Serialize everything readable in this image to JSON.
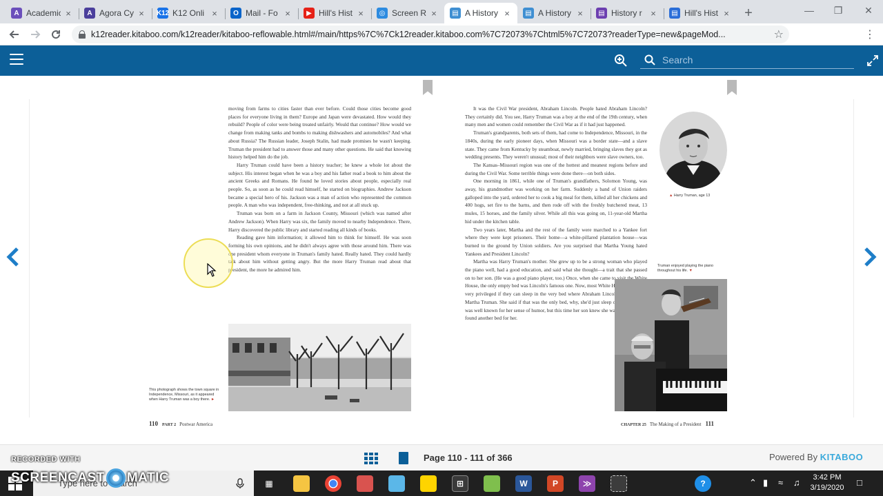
{
  "browser": {
    "tabs": [
      {
        "title": "Academic",
        "fav_letter": "A",
        "fav_color": "#6b4fbb",
        "active": false
      },
      {
        "title": "Agora Cy",
        "fav_letter": "A",
        "fav_color": "#4b3f9c",
        "active": false
      },
      {
        "title": "K12 Onli",
        "fav_letter": "K12",
        "fav_color": "#1a73e8",
        "active": false
      },
      {
        "title": "Mail - Fo",
        "fav_letter": "O",
        "fav_color": "#0a64c9",
        "active": false
      },
      {
        "title": "Hill's Hist",
        "fav_letter": "▶",
        "fav_color": "#e62117",
        "active": false
      },
      {
        "title": "Screen R",
        "fav_letter": "◎",
        "fav_color": "#2d8be0",
        "active": false
      },
      {
        "title": "A History",
        "fav_letter": "▤",
        "fav_color": "#3f8fd2",
        "active": true
      },
      {
        "title": "A History",
        "fav_letter": "▤",
        "fav_color": "#3f8fd2",
        "active": false
      },
      {
        "title": "History r",
        "fav_letter": "▤",
        "fav_color": "#6c3fb0",
        "active": false
      },
      {
        "title": "Hill's Hist",
        "fav_letter": "▤",
        "fav_color": "#2b6ed8",
        "active": false
      }
    ],
    "close_glyph": "×",
    "new_tab_glyph": "+",
    "url": "k12reader.kitaboo.com/k12reader/kitaboo-reflowable.html#/main/https%7C%7Ck12reader.kitaboo.com%7C72073%7Chtml5%7C72073?readerType=new&pageMod..."
  },
  "reader": {
    "search_placeholder": "Search",
    "left_page": {
      "paragraphs": [
        {
          "text": "moving from farms to cities faster than ever before. Could those cities become good places for everyone living in them? Europe and Japan were devastated. How would they rebuild? People of color were being treated unfairly. Would that continue? How would we change from making tanks and bombs to making dishwashers and automobiles? And what about Russia? The Russian leader, Joseph Stalin, had made promises he wasn't keeping. Truman the president had to answer those and many other questions. He said that knowing history helped him do the job.",
          "indent": false
        },
        {
          "text": "Harry Truman could have been a history teacher; he knew a whole lot about the subject. His interest began when he was a boy and his father read a book to him about the ancient Greeks and Romans. He found he loved stories about people, especially real people. So, as soon as he could read himself, he started on biographies. Andrew Jackson became a special hero of his. Jackson was a man of action who represented the common people. A man who was independent, free-thinking, and not at all stuck up.",
          "indent": true
        },
        {
          "text": "Truman was born on a farm in Jackson County, Missouri (which was named after Andrew Jackson). When Harry was six, the family moved to nearby Independence. There, Harry discovered the public library and started reading all kinds of books.",
          "indent": true
        },
        {
          "text": "Reading gave him information; it allowed him to think for himself. He was soon forming his own opinions, and he didn't always agree with those around him. There was one president whom everyone in Truman's family hated. Really hated. They could hardly talk about him without getting angry. But the more Harry Truman read about that president, the more he admired him.",
          "indent": true
        }
      ],
      "photo_caption": "This photograph shows the town square in Independence, Missouri, as it appeared when Harry Truman was a boy there.",
      "folio_number": "110",
      "folio_part": "PART 2",
      "folio_title": "Postwar America"
    },
    "right_page": {
      "paragraphs": [
        {
          "text": "It was the Civil War president, Abraham Lincoln. People hated Abraham Lincoln? They certainly did. You see, Harry Truman was a boy at the end of the 19th century, when many men and women could remember the Civil War as if it had just happened.",
          "indent": true
        },
        {
          "text": "Truman's grandparents, both sets of them, had come to Independence, Missouri, in the 1840s, during the early pioneer days, when Missouri was a border state—and a slave state. They came from Kentucky by steamboat, newly married, bringing slaves they got as wedding presents. They weren't unusual; most of their neighbors were slave owners, too.",
          "indent": true
        },
        {
          "text": "The Kansas–Missouri region was one of the hottest and meanest regions before and during the Civil War. Some terrible things were done there—on both sides.",
          "indent": true
        },
        {
          "text": "One morning in 1861, while one of Truman's grandfathers, Solomon Young, was away, his grandmother was working on her farm. Suddenly a band of Union raiders galloped into the yard, ordered her to cook a big meal for them, killed all her chickens and 400 hogs, set fire to the barns, and then rode off with the freshly butchered meat, 13 mules, 15 horses, and the family silver. While all this was going on, 11-year-old Martha hid under the kitchen table.",
          "indent": true
        },
        {
          "text": "Two years later, Martha and the rest of the family were marched to a Yankee fort where they were kept prisoners. Their home—a white-pillared plantation house—was burned to the ground by Union soldiers. Are you surprised that Martha Young hated Yankees and President Lincoln?",
          "indent": true
        },
        {
          "text": "Martha was Harry Truman's mother. She grew up to be a strong woman who played the piano well, had a good education, and said what she thought—a trait that she passed on to her son. (He was a good piano player, too.) Once, when she came to visit the White House, the only empty bed was Lincoln's famous one. Now, most White House guests feel very privileged if they can sleep in the very bed where Abraham Lincoln slept, but not Martha Truman. She said if that was the only bed, why, she'd just sleep on the floor. She was well known for her sense of humor, but this time her son knew she wasn't kidding. He found another bed for her.",
          "indent": true
        }
      ],
      "portrait_caption": "Harry Truman, age 13",
      "piano_caption": "Truman enjoyed playing the piano throughout his life.",
      "folio_chapter": "CHAPTER 25",
      "folio_title": "The Making of a President",
      "folio_number": "111"
    },
    "page_info": "Page 110 - 111 of 366",
    "powered_by": "Powered By",
    "brand": "KITABOO"
  },
  "taskbar": {
    "search_placeholder": "Type here to search",
    "time": "3:42 PM",
    "date": "3/19/2020"
  },
  "watermark": {
    "top": "RECORDED WITH",
    "left": "SCREENCAST",
    "right": "MATIC"
  }
}
